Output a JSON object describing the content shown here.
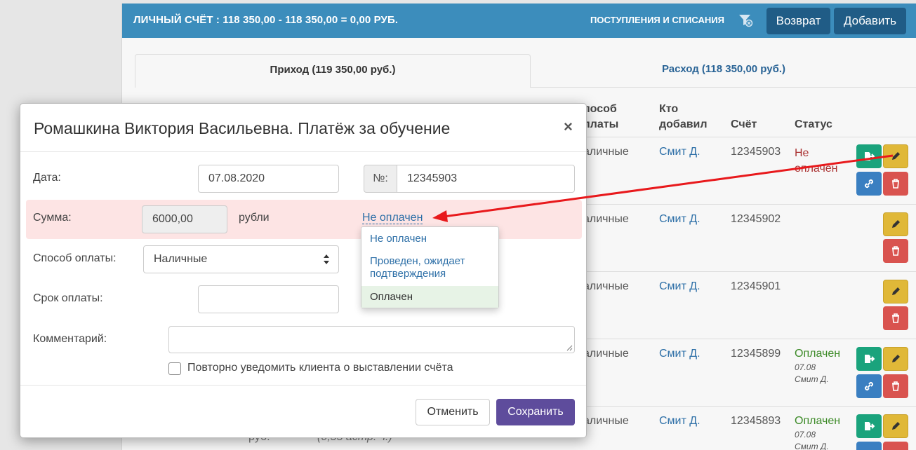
{
  "header": {
    "account_summary": "ЛИЧНЫЙ СЧЁТ :  118 350,00 - 118 350,00 = 0,00 РУБ.",
    "transactions_link": "ПОСТУПЛЕНИЯ И СПИСАНИЯ",
    "filter_icon": "filter-icon",
    "return_button": "Возврат",
    "add_button": "Добавить"
  },
  "tabs": {
    "income": "Приход (119 350,00 руб.)",
    "expense": "Расход (118 350,00 руб.)"
  },
  "table": {
    "headers": {
      "method_line1": "пособ",
      "method_line2": "платы",
      "who_line1": "Кто",
      "who_line2": "добавил",
      "account": "Счёт",
      "status": "Статус"
    },
    "rows": [
      {
        "method": "аличные",
        "who": "Смит Д.",
        "account": "12345903",
        "status_line1": "Не",
        "status_line2": "оплачен",
        "sub_date": "",
        "sub_who": ""
      },
      {
        "method": "аличные",
        "who": "Смит Д.",
        "account": "12345902",
        "status_line1": "",
        "status_line2": "",
        "sub_date": "",
        "sub_who": ""
      },
      {
        "method": "аличные",
        "who": "Смит Д.",
        "account": "12345901",
        "status_line1": "",
        "status_line2": "",
        "sub_date": "",
        "sub_who": ""
      },
      {
        "method": "аличные",
        "who": "Смит Д.",
        "account": "12345899",
        "status_line1": "Оплачен",
        "status_line2": "",
        "sub_date": "07.08",
        "sub_who": "Смит Д."
      },
      {
        "method": "аличные",
        "who": "Смит Д.",
        "account": "12345893",
        "status_line1": "Оплачен",
        "status_line2": "",
        "sub_date": "07.08",
        "sub_who": "Смит Д."
      }
    ],
    "partial_bottom_left": "руб.",
    "partial_bottom_mid": "(0,55 астр. ч.)"
  },
  "modal": {
    "title": "Ромашкина Виктория Васильевна. Платёж за обучение",
    "close": "×",
    "date_label": "Дата:",
    "date_value": "07.08.2020",
    "number_addon": "№:",
    "number_value": "12345903",
    "sum_label": "Сумма:",
    "sum_value": "6000,00",
    "sum_unit": "рубли",
    "status_current": "Не оплачен",
    "payment_method_label": "Способ оплаты:",
    "payment_method_value": "Наличные",
    "due_label": "Срок оплаты:",
    "due_value": "",
    "comment_label": "Комментарий:",
    "comment_value": "",
    "notify_label": "Повторно уведомить клиента о выставлении счёта",
    "notify_checked": false,
    "cancel_button": "Отменить",
    "save_button": "Сохранить"
  },
  "status_dropdown": {
    "options": [
      "Не оплачен",
      "Проведен, ожидает подтверждения",
      "Оплачен"
    ],
    "highlighted": "Оплачен"
  },
  "colors": {
    "header_bg": "#3c8dbc",
    "header_button": "#205c86",
    "save_button": "#5e4c9c",
    "sum_row_bg": "#fde4e4",
    "edit_button": "#e0b838",
    "delete_button": "#d9534f",
    "send_button": "#1aa37c",
    "link_button": "#3a7fc1",
    "annotation_arrow": "#e8191c"
  }
}
